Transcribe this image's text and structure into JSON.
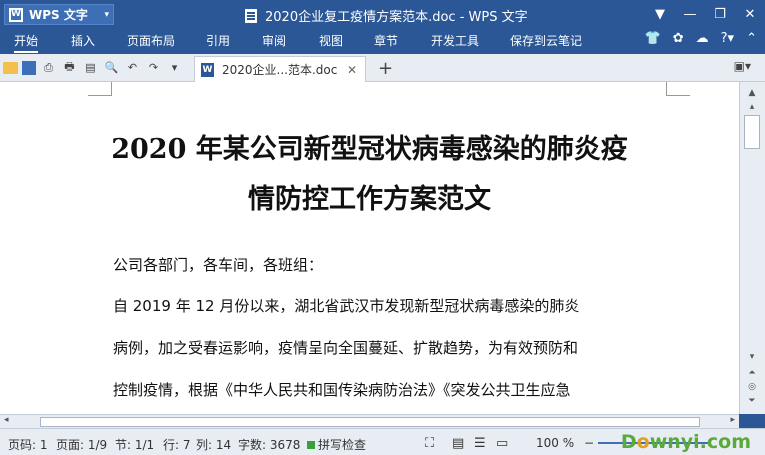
{
  "window": {
    "app_name": "WPS 文字",
    "app_logo": "W",
    "title": "2020企业复工疫情方案范本.doc - WPS 文字"
  },
  "ribbon": {
    "tabs": [
      "开始",
      "插入",
      "页面布局",
      "引用",
      "审阅",
      "视图",
      "章节",
      "开发工具",
      "保存到云笔记"
    ],
    "active_tab": "开始"
  },
  "toolbar": {
    "doc_tab": "2020企业...范本.doc",
    "add_tab": "+"
  },
  "document": {
    "heading_line1": "2020 年某公司新型冠状病毒感染的肺炎疫",
    "heading_line2": "情防控工作方案范文",
    "paragraphs": [
      "公司各部门，各车间，各班组：",
      "自 2019 年 12 月份以来，湖北省武汉市发现新型冠状病毒感染的肺炎",
      "病例，加之受春运影响，疫情呈向全国蔓延、扩散趋势，为有效预防和",
      "控制疫情，根据《中华人民共和国传染病防治法》《突发公共卫生应急"
    ]
  },
  "status": {
    "page_code": "页码: 1",
    "page": "页面: 1/9",
    "section": "节: 1/1",
    "row": "行: 7",
    "col": "列: 14",
    "word_count": "字数: 3678",
    "spell_check": "拼写检查",
    "zoom": "100 %"
  },
  "watermark": {
    "pre": "D",
    "o": "o",
    "post": "wnyi.com"
  },
  "colors": {
    "titlebar": "#2b5797",
    "accent": "#3d6fb8",
    "spell_check": "#3aa03a"
  }
}
